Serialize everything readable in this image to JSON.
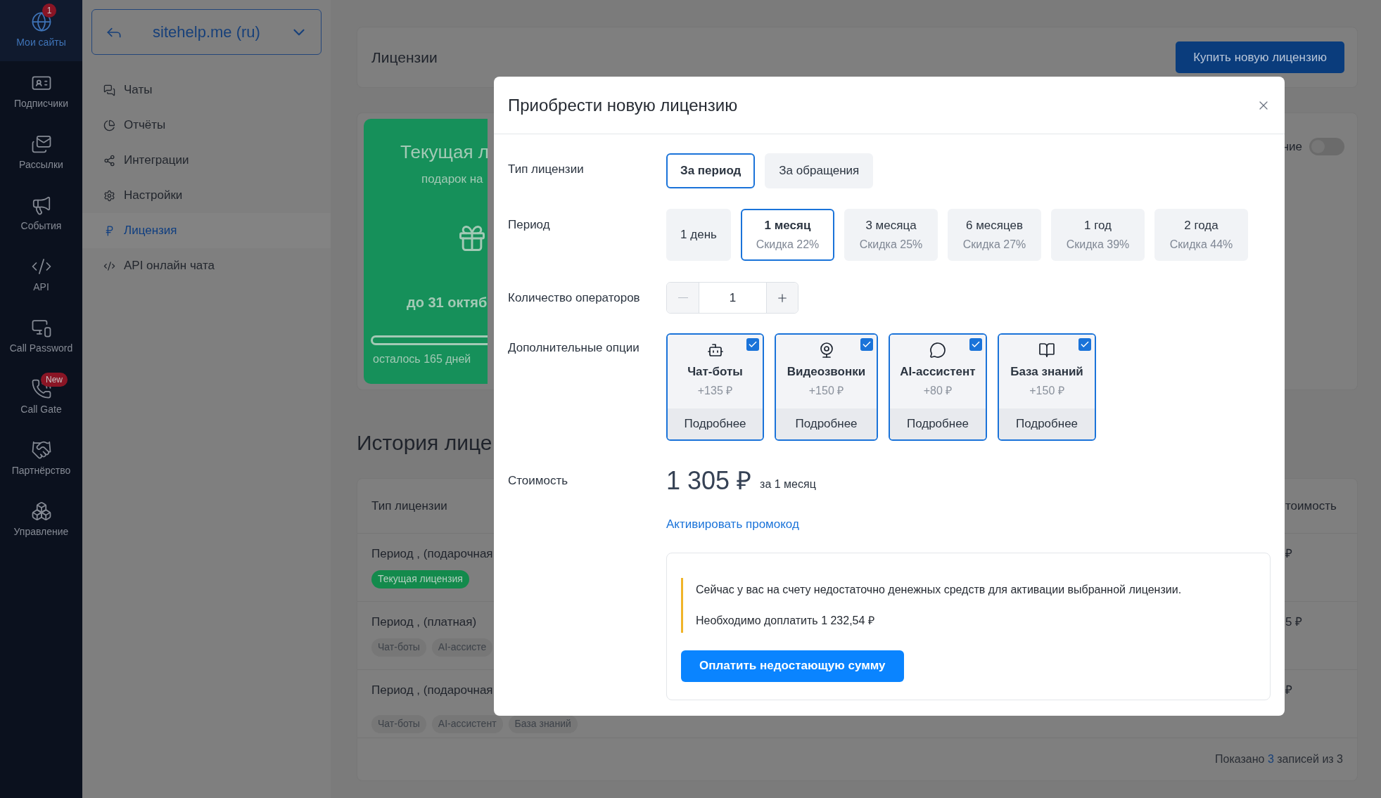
{
  "rail": {
    "items": [
      {
        "label": "Мои сайты",
        "selected": true,
        "badge": {
          "text": "1",
          "kind": "count"
        }
      },
      {
        "label": "Подписчики",
        "selected": false
      },
      {
        "label": "Рассылки",
        "selected": false
      },
      {
        "label": "События",
        "selected": false
      },
      {
        "label": "API",
        "selected": false
      },
      {
        "label": "Call Password",
        "selected": false
      },
      {
        "label": "Call Gate",
        "selected": false,
        "badge": {
          "text": "New",
          "kind": "pill"
        }
      },
      {
        "label": "Партнёрство",
        "selected": false
      },
      {
        "label": "Управление",
        "selected": false
      }
    ]
  },
  "site_selector": {
    "value": "sitehelp.me (ru)"
  },
  "nav": [
    {
      "label": "Чаты",
      "selected": false
    },
    {
      "label": "Отчёты",
      "selected": false
    },
    {
      "label": "Интеграции",
      "selected": false
    },
    {
      "label": "Настройки",
      "selected": false
    },
    {
      "label": "Лицензия",
      "selected": true
    },
    {
      "label": "API онлайн чата",
      "selected": false
    }
  ],
  "page": {
    "title": "Лицензии",
    "buy_button": "Купить новую лицензию",
    "current_license": {
      "title": "Текущая л",
      "subtitle": "подарок на",
      "until": "до 31 октяб",
      "remaining": "осталось 165 дней"
    },
    "toggle": {
      "label": "ние",
      "on": false
    },
    "history": {
      "title": "История лице",
      "columns": [
        "Тип лицензии",
        "тоимость"
      ],
      "rows": [
        {
          "type": "Период , (подарочная",
          "tags": [
            {
              "label": "Текущая лицензия",
              "kind": "current"
            }
          ],
          "cost": "₽"
        },
        {
          "type": "Период , (платная)",
          "tags": [
            {
              "label": "Чат-боты",
              "kind": "option"
            },
            {
              "label": "AI-ассисте",
              "kind": "option"
            }
          ],
          "cost": "5 ₽"
        },
        {
          "type": "Период , (подарочная",
          "tags": [
            {
              "label": "Чат-боты",
              "kind": "option"
            },
            {
              "label": "AI-ассистент",
              "kind": "option"
            },
            {
              "label": "База знаний",
              "kind": "option"
            }
          ],
          "cost": "₽"
        }
      ],
      "footer": {
        "prefix": "Показано",
        "count": "3",
        "suffix": "записей из 3"
      }
    }
  },
  "modal": {
    "title": "Приобрести новую лицензию",
    "license_type": {
      "label": "Тип лицензии",
      "options": [
        {
          "label": "За период",
          "selected": true
        },
        {
          "label": "За обращения",
          "selected": false
        }
      ]
    },
    "period": {
      "label": "Период",
      "options": [
        {
          "label": "1 день",
          "selected": false
        },
        {
          "label": "1 месяц",
          "discount": "Скидка 22%",
          "selected": true
        },
        {
          "label": "3 месяца",
          "discount": "Скидка 25%",
          "selected": false
        },
        {
          "label": "6 месяцев",
          "discount": "Скидка 27%",
          "selected": false
        },
        {
          "label": "1 год",
          "discount": "Скидка 39%",
          "selected": false
        },
        {
          "label": "2 года",
          "discount": "Скидка 44%",
          "selected": false
        }
      ]
    },
    "operators": {
      "label": "Количество операторов",
      "value": "1",
      "minus_disabled": true
    },
    "options": {
      "label": "Дополнительные опции",
      "items": [
        {
          "name": "Чат-боты",
          "price": "+135 ₽",
          "details": "Подробнее",
          "checked": true
        },
        {
          "name": "Видеозвонки",
          "price": "+150 ₽",
          "details": "Подробнее",
          "checked": true
        },
        {
          "name": "AI-ассистент",
          "price": "+80 ₽",
          "details": "Подробнее",
          "checked": true
        },
        {
          "name": "База знаний",
          "price": "+150 ₽",
          "details": "Подробнее",
          "checked": true
        }
      ]
    },
    "cost": {
      "label": "Стоимость",
      "amount": "1 305 ₽",
      "per": "за 1 месяц"
    },
    "promo_link": "Активировать промокод",
    "notice": {
      "message": "Сейчас у вас на счету недостаточно денежных средств для активации выбранной лицензии.",
      "due": "Необходимо доплатить 1 232,54 ₽",
      "button": "Оплатить недостающую сумму"
    }
  }
}
